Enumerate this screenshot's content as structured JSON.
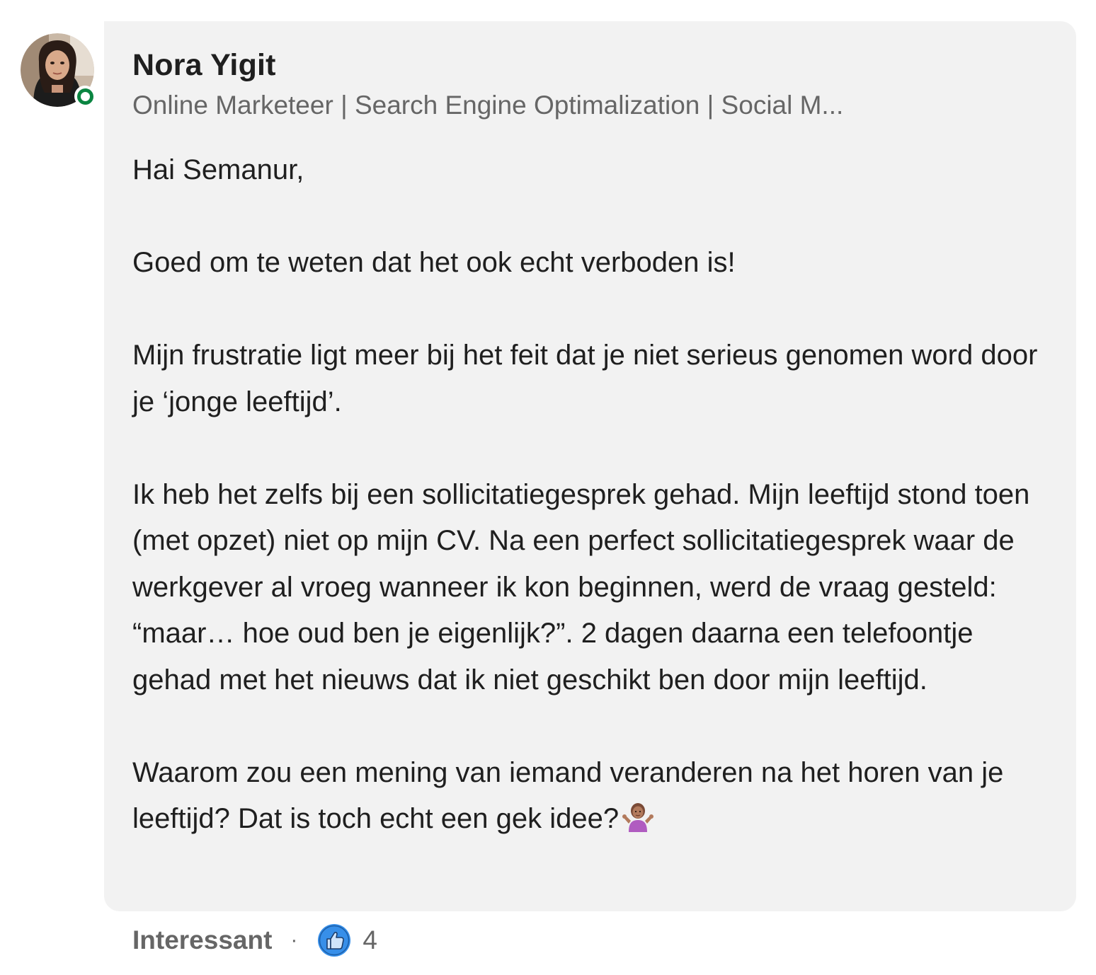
{
  "comment": {
    "author": {
      "name": "Nora Yigit",
      "headline": "Online Marketeer | Search Engine Optimalization | Social M...",
      "avatar_icon": "profile-photo",
      "presence_status": "online",
      "presence_color": "#0a8541"
    },
    "paragraphs": [
      "Hai Semanur,",
      "Goed om te weten dat het ook echt verboden is!",
      "Mijn frustratie ligt meer bij het feit dat je niet serieus genomen word door je ‘jonge leeftijd’.",
      "Ik heb het zelfs bij een sollicitatiegesprek gehad. Mijn leeftijd stond toen (met opzet) niet op mijn CV. Na een perfect sollicitatiegesprek waar de werkgever al vroeg wanneer ik kon beginnen, werd de vraag gesteld: “maar… hoe oud ben je eigenlijk?”. 2 dagen daarna een telefoontje gehad met het nieuws dat ik niet geschikt ben door mijn leeftijd.",
      "Waarom zou een mening van iemand veranderen na het horen van je leeftijd? Dat is toch echt een gek idee?"
    ],
    "trailing_emoji": "person-shrugging-emoji",
    "bubble_color": "#f2f2f2"
  },
  "footer": {
    "reaction_label": "Interessant",
    "separator": "·",
    "reaction_icon": "like-thumbs-up-icon",
    "reaction_count": "4",
    "like_color": "#378fe9"
  }
}
